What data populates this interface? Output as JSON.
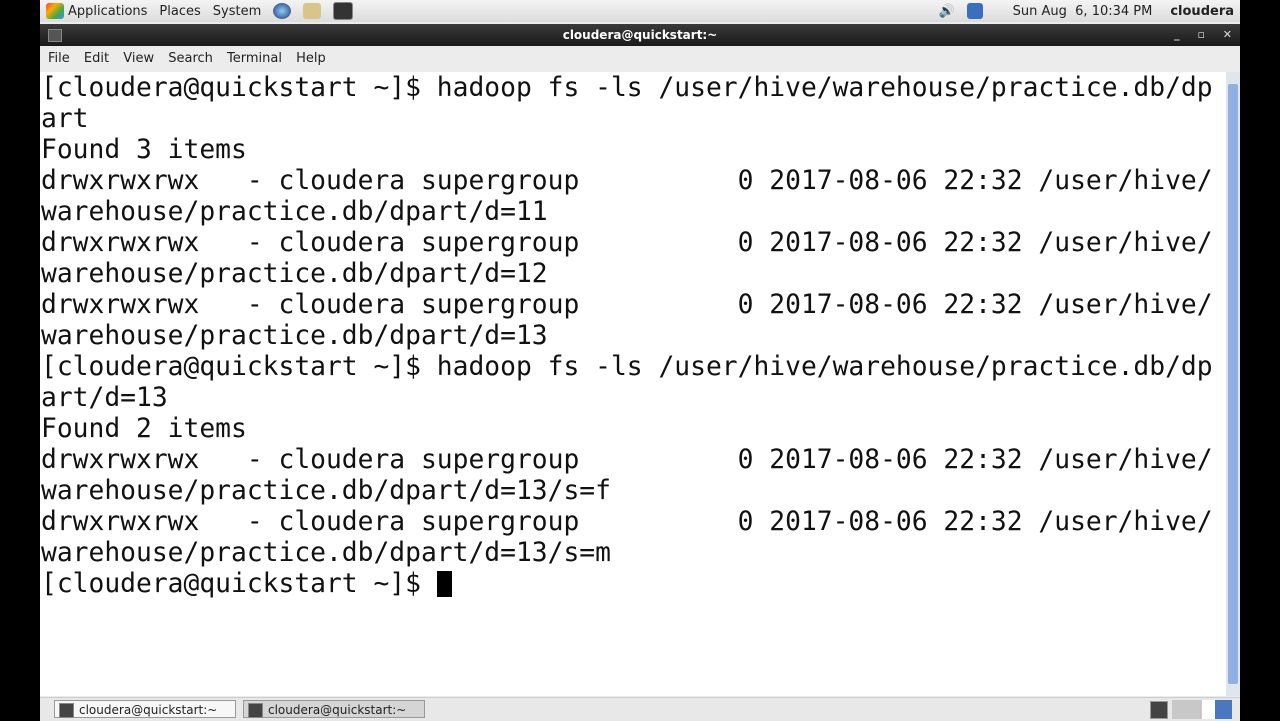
{
  "panel": {
    "menus": [
      "Applications",
      "Places",
      "System"
    ],
    "clock": "Sun Aug  6, 10:34 PM",
    "user": "cloudera"
  },
  "window": {
    "title": "cloudera@quickstart:~",
    "menu": [
      "File",
      "Edit",
      "View",
      "Search",
      "Terminal",
      "Help"
    ]
  },
  "terminal": {
    "lines": [
      "[cloudera@quickstart ~]$ hadoop fs -ls /user/hive/warehouse/practice.db/dp",
      "art",
      "Found 3 items",
      "drwxrwxrwx   - cloudera supergroup          0 2017-08-06 22:32 /user/hive/",
      "warehouse/practice.db/dpart/d=11",
      "drwxrwxrwx   - cloudera supergroup          0 2017-08-06 22:32 /user/hive/",
      "warehouse/practice.db/dpart/d=12",
      "drwxrwxrwx   - cloudera supergroup          0 2017-08-06 22:32 /user/hive/",
      "warehouse/practice.db/dpart/d=13",
      "[cloudera@quickstart ~]$ hadoop fs -ls /user/hive/warehouse/practice.db/dp",
      "art/d=13",
      "Found 2 items",
      "drwxrwxrwx   - cloudera supergroup          0 2017-08-06 22:32 /user/hive/",
      "warehouse/practice.db/dpart/d=13/s=f",
      "drwxrwxrwx   - cloudera supergroup          0 2017-08-06 22:32 /user/hive/",
      "warehouse/practice.db/dpart/d=13/s=m",
      "[cloudera@quickstart ~]$ "
    ]
  },
  "taskbar": {
    "tasks": [
      "cloudera@quickstart:~",
      "cloudera@quickstart:~"
    ]
  }
}
